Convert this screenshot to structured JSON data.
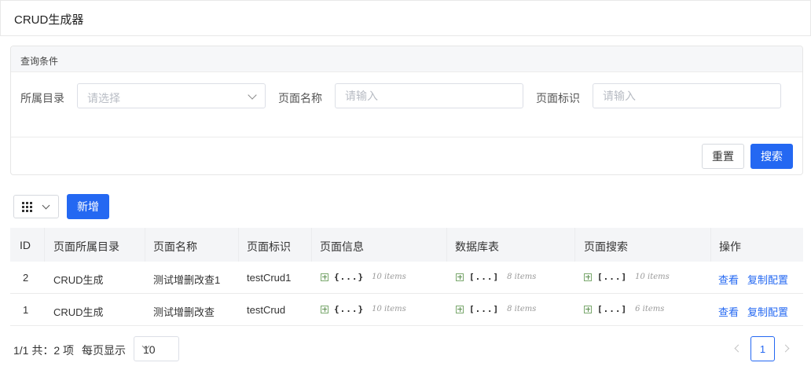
{
  "header": {
    "title": "CRUD生成器"
  },
  "filter": {
    "title": "查询条件",
    "fields": [
      {
        "label": "所属目录",
        "placeholder": "请选择"
      },
      {
        "label": "页面名称",
        "placeholder": "请输入"
      },
      {
        "label": "页面标识",
        "placeholder": "请输入"
      }
    ],
    "reset_label": "重置",
    "search_label": "搜索"
  },
  "toolbar": {
    "add_label": "新增"
  },
  "table": {
    "columns": [
      "ID",
      "页面所属目录",
      "页面名称",
      "页面标识",
      "页面信息",
      "数据库表",
      "页面搜索",
      "操作"
    ],
    "rows": [
      {
        "id": "2",
        "dir": "CRUD生成",
        "name": "测试增删改查1",
        "key": "testCrud1",
        "info": {
          "bracket": "{...}",
          "count": "10 items"
        },
        "db": {
          "bracket": "[...]",
          "count": "8 items"
        },
        "search": {
          "bracket": "[...]",
          "count": "10 items"
        },
        "view_label": "查看",
        "copy_label": "复制配置"
      },
      {
        "id": "1",
        "dir": "CRUD生成",
        "name": "测试增删改查",
        "key": "testCrud",
        "info": {
          "bracket": "{...}",
          "count": "10 items"
        },
        "db": {
          "bracket": "[...]",
          "count": "8 items"
        },
        "search": {
          "bracket": "[...]",
          "count": "6 items"
        },
        "view_label": "查看",
        "copy_label": "复制配置"
      }
    ]
  },
  "pagination": {
    "summary": "1/1 共：2 项",
    "per_page_label": "每页显示",
    "per_page_value": "10",
    "current_page": "1"
  },
  "colors": {
    "primary": "#2468f2",
    "json_expand": "#5c8f50"
  }
}
